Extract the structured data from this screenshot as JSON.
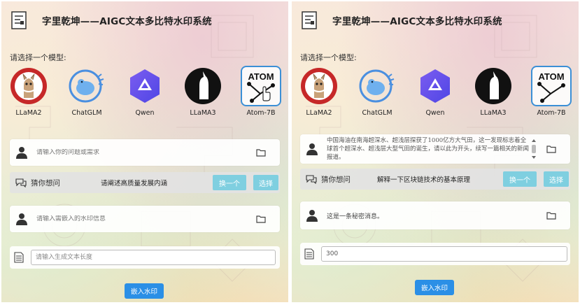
{
  "app": {
    "title": "字里乾坤——AIGC文本多比特水印系统",
    "model_prompt": "请选择一个模型:"
  },
  "models": [
    {
      "id": "llama2",
      "label": "LLaMA2"
    },
    {
      "id": "chatglm",
      "label": "ChatGLM"
    },
    {
      "id": "qwen",
      "label": "Qwen"
    },
    {
      "id": "llama3",
      "label": "LLaMA3"
    },
    {
      "id": "atom",
      "label": "Atom-7B",
      "logo_text": "ATOM"
    }
  ],
  "selected_model": "Atom-7B",
  "guess": {
    "label": "猜你想问",
    "refresh_label": "换一个",
    "select_label": "选择"
  },
  "embed_label": "嵌入水印",
  "left": {
    "question_placeholder": "请输入你的问题或需求",
    "guess_suggestion": "请阐述高质量发展内涵",
    "watermark_placeholder": "请输入需嵌入的水印信息",
    "length_placeholder": "请输入生成文本长度"
  },
  "right": {
    "question_text": "中国海油在南海超深水、超浅层探获了1000亿方大气田，这一发现标志着全球首个超深水、超浅层大型气田的诞生，请以此为开头，续写一篇相关的新闻报道。",
    "guess_suggestion": "解释一下区块链技术的基本原理",
    "watermark_text": "这是一条秘密消息。",
    "length_value": "300"
  },
  "colors": {
    "accent_teal": "#7fcfe0",
    "embed_blue": "#2b8fe6",
    "selected_border": "#3b8fd6"
  }
}
